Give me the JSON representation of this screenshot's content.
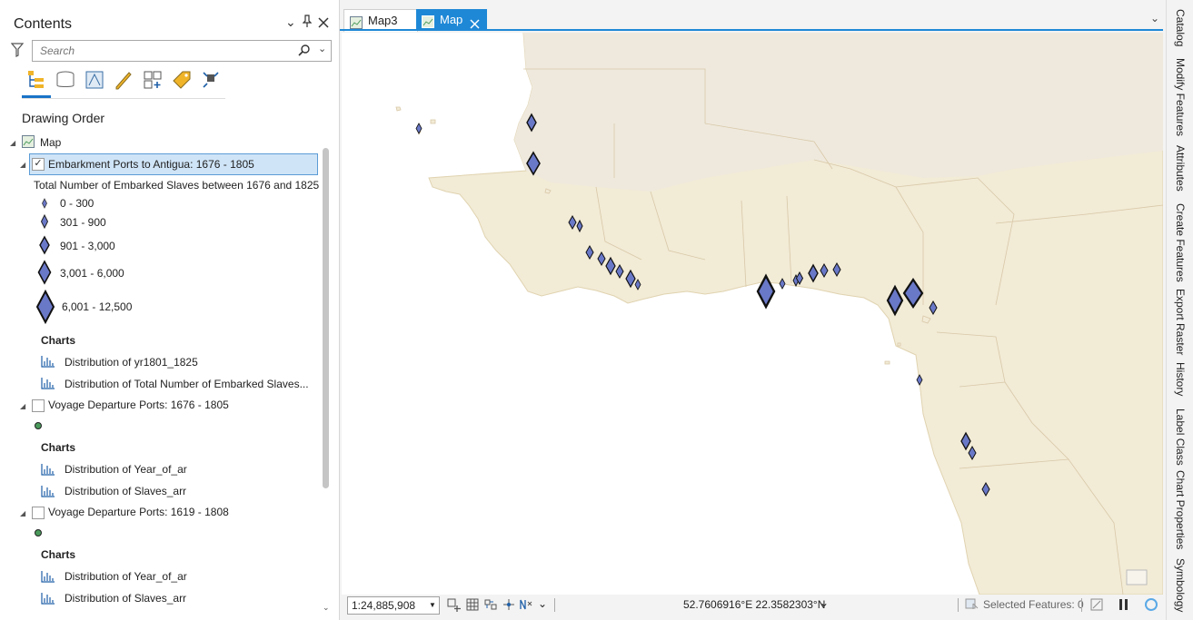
{
  "contents": {
    "title": "Contents",
    "search_placeholder": "Search",
    "drawing_order": "Drawing Order",
    "map_label": "Map",
    "layers": [
      {
        "name": "Embarkment Ports to Antigua: 1676 - 1805",
        "checked": true,
        "legend_title": "Total Number of Embarked Slaves between 1676 and 1825",
        "classes": [
          "0 - 300",
          "301 - 900",
          "901 - 3,000",
          "3,001 - 6,000",
          "6,001 - 12,500"
        ],
        "charts_label": "Charts",
        "charts": [
          "Distribution of yr1801_1825",
          "Distribution of Total Number of Embarked Slaves..."
        ]
      },
      {
        "name": "Voyage Departure Ports: 1676 - 1805",
        "checked": false,
        "charts_label": "Charts",
        "charts": [
          "Distribution of Year_of_ar",
          "Distribution of Slaves_arr"
        ]
      },
      {
        "name": "Voyage Departure Ports: 1619 - 1808",
        "checked": false,
        "charts_label": "Charts",
        "charts": [
          "Distribution of Year_of_ar",
          "Distribution of Slaves_arr"
        ]
      }
    ]
  },
  "tabs": [
    {
      "label": "Map3",
      "active": false
    },
    {
      "label": "Map",
      "active": true
    }
  ],
  "statusbar": {
    "scale": "1:24,885,908",
    "coordinates": "52.7606916°E 22.3582303°N",
    "selected_features": "Selected Features: 0"
  },
  "right_dock": [
    "Catalog",
    "Modify Features",
    "Attributes",
    "Create Features",
    "Export Raster",
    "History",
    "Label Class",
    "Chart Properties",
    "Symbology"
  ],
  "colors": {
    "accent": "#1e88d6",
    "symbol_fill": "#6a78c8",
    "land": "#f2ebd6",
    "selected_row": "#cfe4f7"
  }
}
